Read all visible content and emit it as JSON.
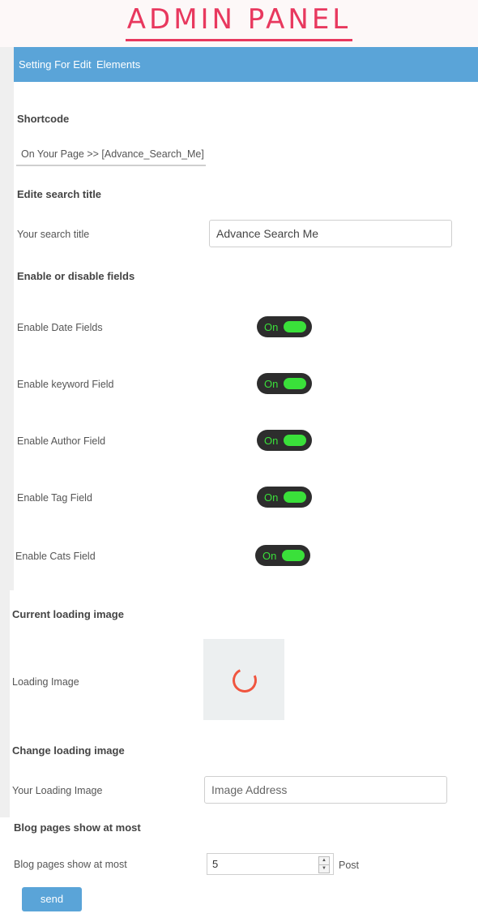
{
  "header": {
    "title": "ADMIN PANEL"
  },
  "nav": {
    "tabs": [
      {
        "label": "Setting For Edit"
      },
      {
        "label": "Elements"
      }
    ]
  },
  "shortcode": {
    "section_title": "Shortcode",
    "value": "On Your Page >> [Advance_Search_Me]"
  },
  "search_title": {
    "section_title": "Edite search title",
    "label": "Your search title",
    "value": "Advance Search Me"
  },
  "fields": {
    "section_title": "Enable or disable fields",
    "items": [
      {
        "label": "Enable Date Fields",
        "state": "On"
      },
      {
        "label": "Enable keyword Field",
        "state": "On"
      },
      {
        "label": "Enable Author Field",
        "state": "On"
      },
      {
        "label": "Enable Tag Field",
        "state": "On"
      },
      {
        "label": "Enable Cats Field",
        "state": "On"
      }
    ]
  },
  "loading_image": {
    "section_title": "Current loading image",
    "label": "Loading Image",
    "icon": "spinner-icon"
  },
  "change_loading": {
    "section_title": "Change loading image",
    "label": "Your Loading Image",
    "placeholder": "Image Address"
  },
  "blog_pages": {
    "section_title": "Blog pages show at most",
    "label": "Blog pages show at most",
    "value": "5",
    "unit": "Post"
  },
  "actions": {
    "send_label": "send"
  },
  "colors": {
    "accent": "#5aa4d8",
    "title": "#e8385e",
    "toggle_on": "#3ae03a",
    "toggle_bg": "#2d2d2d",
    "spinner": "#f0553f"
  }
}
